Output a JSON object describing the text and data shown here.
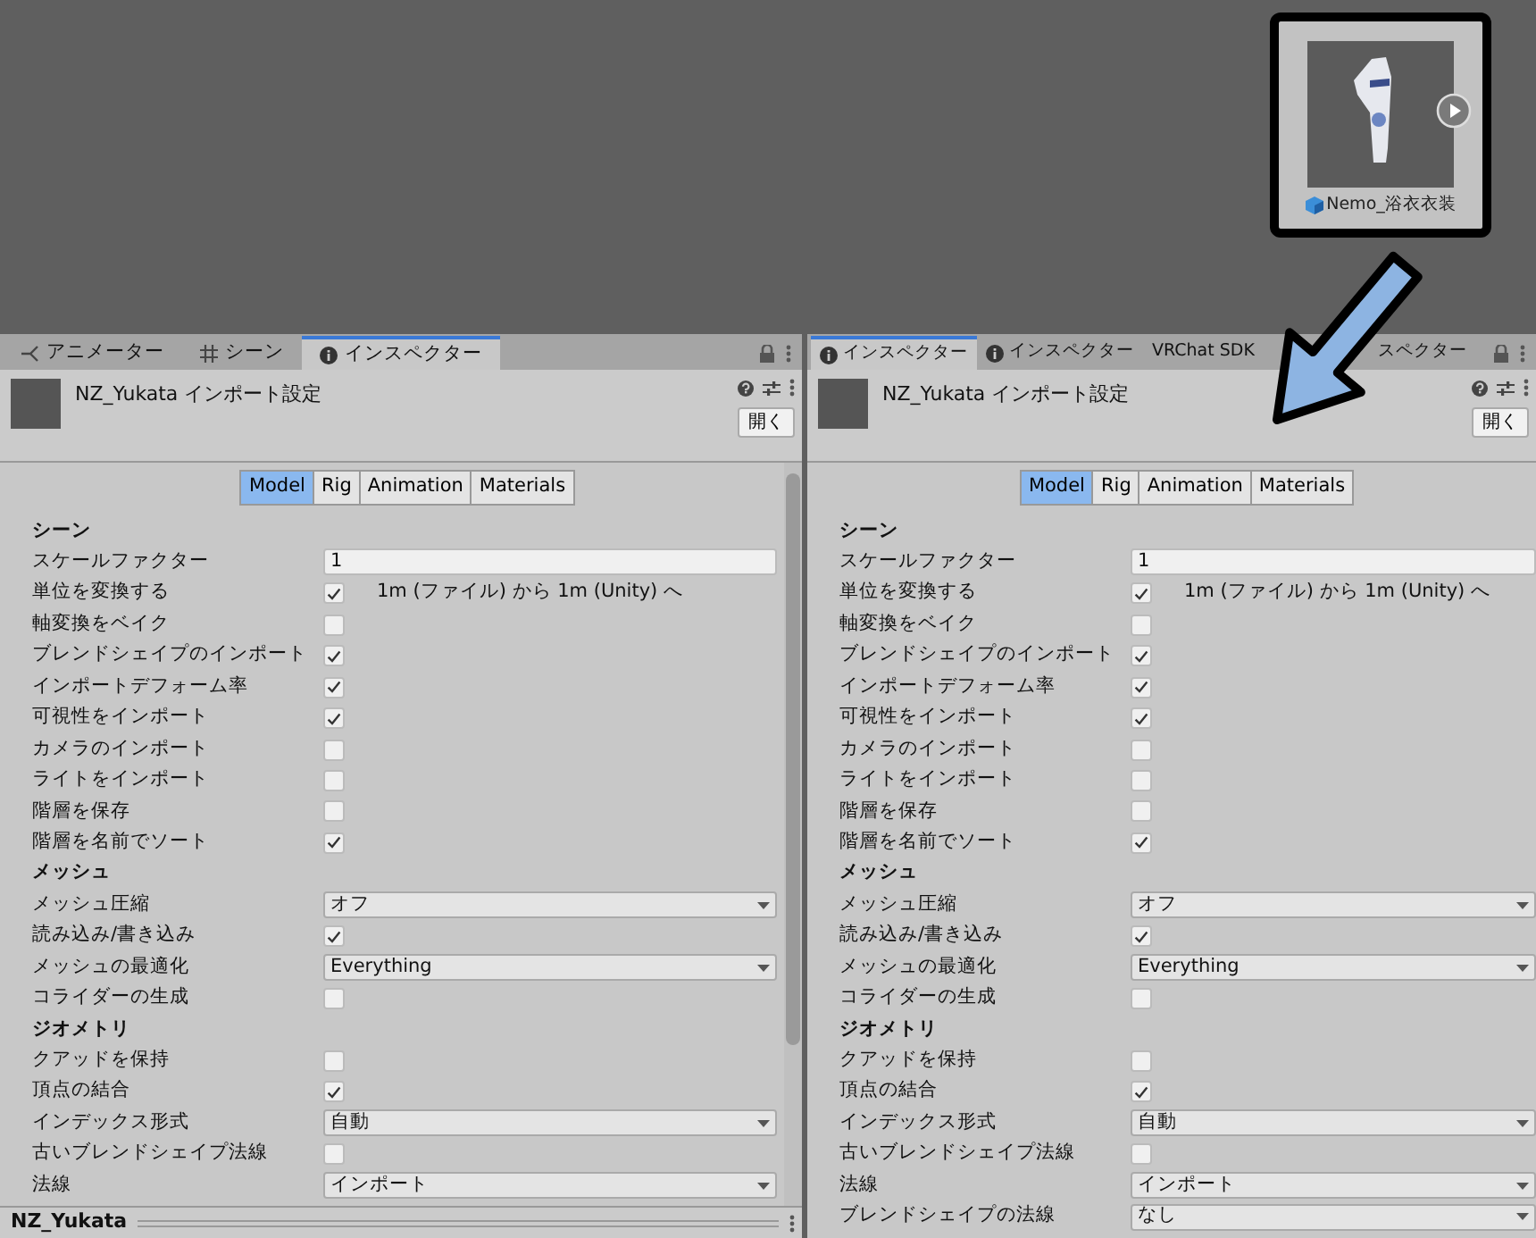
{
  "asset_tile": {
    "label": "Nemo_浴衣衣装"
  },
  "panels": [
    {
      "tabs": [
        {
          "kind": "animator",
          "label": "アニメーター",
          "selected": false
        },
        {
          "kind": "scene",
          "label": "シーン",
          "selected": false
        },
        {
          "kind": "info",
          "label": "インスペクター",
          "selected": true
        }
      ],
      "title": "NZ_Yukata インポート設定",
      "open_button": "開く",
      "subtabs": [
        {
          "label": "Model",
          "selected": true
        },
        {
          "label": "Rig",
          "selected": false
        },
        {
          "label": "Animation",
          "selected": false
        },
        {
          "label": "Materials",
          "selected": false
        }
      ],
      "rows": [
        {
          "kind": "section",
          "label": "シーン"
        },
        {
          "kind": "text",
          "label": "スケールファクター",
          "value": "1"
        },
        {
          "kind": "check",
          "label": "単位を変換する",
          "checked": true,
          "note": "1m (ファイル) から 1m (Unity) へ"
        },
        {
          "kind": "check",
          "label": "軸変換をベイク",
          "checked": false
        },
        {
          "kind": "check",
          "label": "ブレンドシェイプのインポート",
          "checked": true
        },
        {
          "kind": "check",
          "label": "インポートデフォーム率",
          "checked": true
        },
        {
          "kind": "check",
          "label": "可視性をインポート",
          "checked": true
        },
        {
          "kind": "check",
          "label": "カメラのインポート",
          "checked": false
        },
        {
          "kind": "check",
          "label": "ライトをインポート",
          "checked": false
        },
        {
          "kind": "check",
          "label": "階層を保存",
          "checked": false
        },
        {
          "kind": "check",
          "label": "階層を名前でソート",
          "checked": true
        },
        {
          "kind": "section",
          "label": "メッシュ"
        },
        {
          "kind": "dropdown",
          "label": "メッシュ圧縮",
          "value": "オフ"
        },
        {
          "kind": "check",
          "label": "読み込み/書き込み",
          "checked": true
        },
        {
          "kind": "dropdown",
          "label": "メッシュの最適化",
          "value": "Everything"
        },
        {
          "kind": "check",
          "label": "コライダーの生成",
          "checked": false
        },
        {
          "kind": "section",
          "label": "ジオメトリ"
        },
        {
          "kind": "check",
          "label": "クアッドを保持",
          "checked": false
        },
        {
          "kind": "check",
          "label": "頂点の結合",
          "checked": true
        },
        {
          "kind": "dropdown",
          "label": "インデックス形式",
          "value": "自動"
        },
        {
          "kind": "check",
          "label": "古いブレンドシェイプ法線",
          "checked": false
        },
        {
          "kind": "dropdown",
          "label": "法線",
          "value": "インポート"
        }
      ],
      "footer": {
        "title": "NZ_Yukata"
      }
    },
    {
      "tabs": [
        {
          "kind": "info",
          "label": "インスペクター",
          "selected": true
        },
        {
          "kind": "info",
          "label": "インスペクター",
          "selected": false
        },
        {
          "kind": "plain",
          "label": "VRChat SDK",
          "selected": false
        },
        {
          "kind": "plain",
          "label": "スペクター",
          "selected": false
        }
      ],
      "title": "NZ_Yukata インポート設定",
      "open_button": "開く",
      "subtabs": [
        {
          "label": "Model",
          "selected": true
        },
        {
          "label": "Rig",
          "selected": false
        },
        {
          "label": "Animation",
          "selected": false
        },
        {
          "label": "Materials",
          "selected": false
        }
      ],
      "rows": [
        {
          "kind": "section",
          "label": "シーン"
        },
        {
          "kind": "text",
          "label": "スケールファクター",
          "value": "1"
        },
        {
          "kind": "check",
          "label": "単位を変換する",
          "checked": true,
          "note": "1m (ファイル) から 1m (Unity) へ"
        },
        {
          "kind": "check",
          "label": "軸変換をベイク",
          "checked": false
        },
        {
          "kind": "check",
          "label": "ブレンドシェイプのインポート",
          "checked": true
        },
        {
          "kind": "check",
          "label": "インポートデフォーム率",
          "checked": true
        },
        {
          "kind": "check",
          "label": "可視性をインポート",
          "checked": true
        },
        {
          "kind": "check",
          "label": "カメラのインポート",
          "checked": false
        },
        {
          "kind": "check",
          "label": "ライトをインポート",
          "checked": false
        },
        {
          "kind": "check",
          "label": "階層を保存",
          "checked": false
        },
        {
          "kind": "check",
          "label": "階層を名前でソート",
          "checked": true
        },
        {
          "kind": "section",
          "label": "メッシュ"
        },
        {
          "kind": "dropdown",
          "label": "メッシュ圧縮",
          "value": "オフ"
        },
        {
          "kind": "check",
          "label": "読み込み/書き込み",
          "checked": true
        },
        {
          "kind": "dropdown",
          "label": "メッシュの最適化",
          "value": "Everything"
        },
        {
          "kind": "check",
          "label": "コライダーの生成",
          "checked": false
        },
        {
          "kind": "section",
          "label": "ジオメトリ"
        },
        {
          "kind": "check",
          "label": "クアッドを保持",
          "checked": false
        },
        {
          "kind": "check",
          "label": "頂点の結合",
          "checked": true
        },
        {
          "kind": "dropdown",
          "label": "インデックス形式",
          "value": "自動"
        },
        {
          "kind": "check",
          "label": "古いブレンドシェイプ法線",
          "checked": false
        },
        {
          "kind": "dropdown",
          "label": "法線",
          "value": "インポート"
        },
        {
          "kind": "dropdown",
          "label": "ブレンドシェイプの法線",
          "value": "なし"
        }
      ]
    }
  ]
}
